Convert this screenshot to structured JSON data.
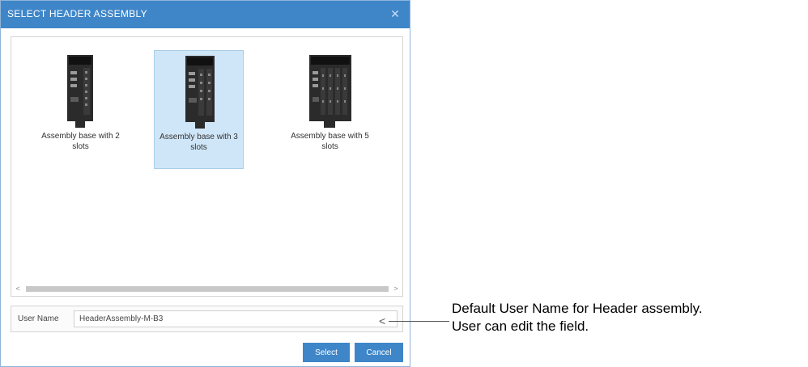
{
  "dialog": {
    "title": "SELECT HEADER ASSEMBLY",
    "close_icon": "close-icon"
  },
  "assemblies": [
    {
      "label": "Assembly base with 2 slots",
      "slots": 2,
      "selected": false
    },
    {
      "label": "Assembly base with 3 slots",
      "slots": 3,
      "selected": true
    },
    {
      "label": "Assembly base with 5 slots",
      "slots": 5,
      "selected": false
    }
  ],
  "scrollbar": {
    "left_icon": "chevron-left-icon",
    "right_icon": "chevron-right-icon"
  },
  "user_name": {
    "label": "User Name",
    "value": "HeaderAssembly-M-B3"
  },
  "buttons": {
    "select_label": "Select",
    "cancel_label": "Cancel"
  },
  "annotation": {
    "line1": "Default User Name for Header assembly.",
    "line2": "User can edit the field."
  },
  "colors": {
    "titlebar": "#3f86c8",
    "selected_tile": "#cfe6f8",
    "button": "#3f86c8"
  }
}
